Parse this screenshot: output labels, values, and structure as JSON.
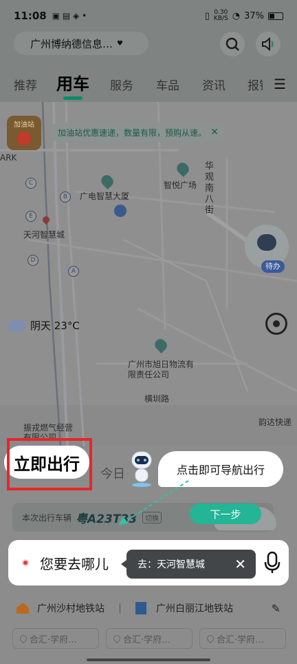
{
  "status_bar": {
    "time": "11:08",
    "net_speed_top": "0.30",
    "net_speed_unit": "KB/S",
    "battery": "37%"
  },
  "header": {
    "company": "广州博纳德信息…",
    "search_icon": "search-icon",
    "voice_icon": "speaker-icon"
  },
  "tabs": [
    "推荐",
    "用车",
    "服务",
    "车品",
    "资讯",
    "报销"
  ],
  "active_tab": "用车",
  "map": {
    "promo_text": "加油站优惠速递，数量有限，预购从速。",
    "gas_badge": "加油站",
    "labels": {
      "ark": "ARK",
      "guangdian": "广电智慧大厦",
      "zhiyue": "智悦广场",
      "tianhe": "天河智慧城",
      "huajingnan": "华观南八街",
      "xuri": "广州市旭日物流有限责任公司",
      "hengzhen": "横圳路",
      "zhenrong": "振戎燃气经营有限公司",
      "yunda": "韵达快递"
    },
    "metro_letters": [
      "C",
      "B",
      "E",
      "D",
      "A"
    ],
    "robot_badge": "待办",
    "weather": "阴天 23°C"
  },
  "card": {
    "today": "今日",
    "plate_label": "本次出行车辆",
    "plate_number": "粤A23T33",
    "switch": "切换",
    "search_placeholder": "您要去哪儿",
    "destination": "去：天河智慧城",
    "stations": [
      "广州沙村地铁站",
      "广州白丽江地铁站"
    ],
    "chips": [
      "合汇·学府…",
      "合汇·学府…",
      "合汇·学府…"
    ]
  },
  "guide": {
    "cta": "立即出行",
    "tip": "点击即可导航出行",
    "next": "下一步"
  },
  "colors": {
    "accent": "#24b496",
    "highlight": "#e8262a",
    "tab_underline": "#0b8a6a"
  }
}
